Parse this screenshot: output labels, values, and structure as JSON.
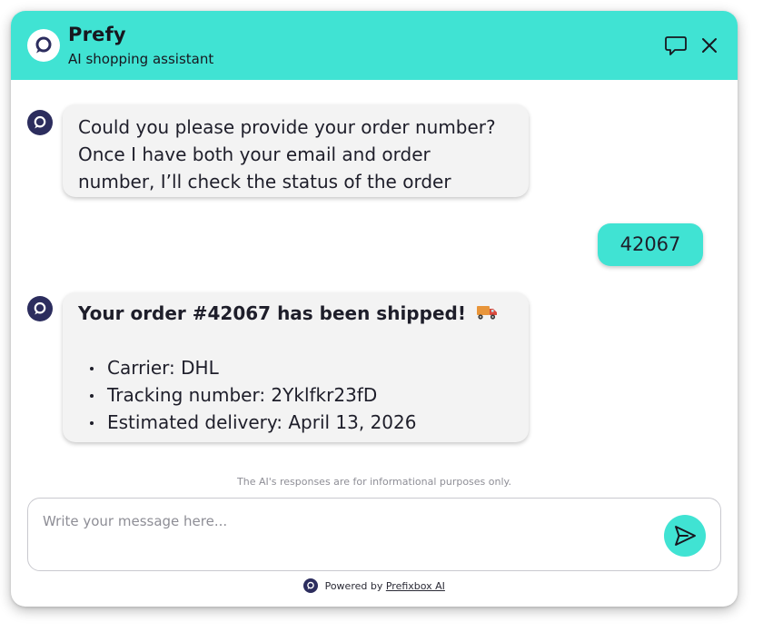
{
  "header": {
    "title": "Prefy",
    "subtitle": "AI shopping assistant",
    "icons": {
      "logo": "chat-bubble-logo-icon",
      "new_chat": "speech-bubble-icon",
      "close": "close-icon"
    }
  },
  "messages": [
    {
      "role": "assistant",
      "lines": [
        "Could you please provide your order number?",
        "Once I have both your email and order",
        "number, I’ll check the status of the order"
      ]
    },
    {
      "role": "user",
      "text": "42067"
    },
    {
      "role": "assistant",
      "headline": "Your order #42067 has been shipped!",
      "headline_icon": "delivery-truck-icon",
      "items": [
        "Carrier: DHL",
        "Tracking number: 2Yklfkr23fD",
        "Estimated delivery: April 13, 2026"
      ]
    }
  ],
  "disclaimer": "The AI's responses are for informational purposes only.",
  "composer": {
    "placeholder": "Write your message here...",
    "value": "",
    "send_icon": "send-icon"
  },
  "footer": {
    "powered_prefix": "Powered by",
    "powered_link": "Prefixbox AI"
  },
  "colors": {
    "accent": "#40e3d3",
    "avatar": "#2c2d5e",
    "assistant_bubble": "#f3f3f3",
    "text": "#1e1e2a"
  }
}
